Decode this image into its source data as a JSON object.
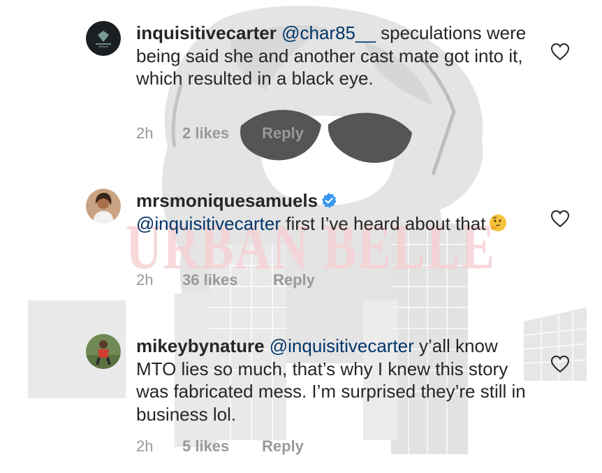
{
  "comments": [
    {
      "username": "inquisitivecarter",
      "mention": "@char85__",
      "text": "speculations were being said she and another cast mate got into it, which resulted in a black eye.",
      "time": "2h",
      "likes": "2 likes",
      "reply": "Reply",
      "verified": false,
      "avatar_icon": "dark-logo-avatar"
    },
    {
      "username": "mrsmoniquesamuels",
      "mention": "@inquisitivecarter",
      "text": "first I’ve heard about that",
      "emoji": "🤔",
      "time": "2h",
      "likes": "36 likes",
      "reply": "Reply",
      "verified": true,
      "avatar_icon": "woman-portrait-avatar"
    },
    {
      "username": "mikeybynature",
      "mention": "@inquisitivecarter",
      "text": "y’all know MTO lies so much, that’s why I knew this story was fabricated mess. I’m surprised they’re still in business lol.",
      "time": "2h",
      "likes": "5 likes",
      "reply": "Reply",
      "verified": false,
      "avatar_icon": "man-outdoors-avatar"
    }
  ],
  "watermark": "URBAN BELLE",
  "colors": {
    "text": "#262626",
    "mention": "#003569",
    "meta": "#999999",
    "verified": "#3897f0",
    "watermark": "#f6cfd3"
  }
}
